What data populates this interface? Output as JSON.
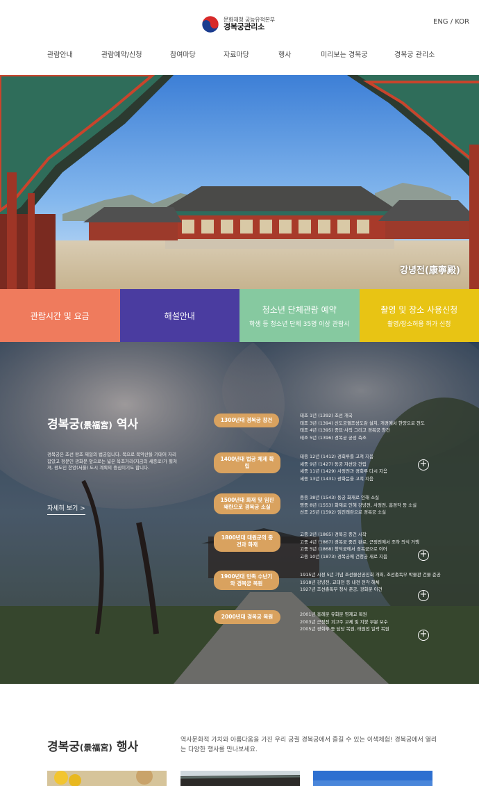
{
  "header": {
    "logo_sub": "문화재청 궁능유적본부",
    "logo_main": "경복궁관리소",
    "lang": "ENG / KOR"
  },
  "nav": [
    "관람안내",
    "관람예약/신청",
    "참여마당",
    "자료마당",
    "행사",
    "미리보는 경복궁",
    "경복궁 관리소"
  ],
  "hero": {
    "caption": "강녕전(康寧殿)"
  },
  "tiles": [
    {
      "title": "관람시간 및 요금",
      "sub": "",
      "color": "#ef7b5d"
    },
    {
      "title": "해설안내",
      "sub": "",
      "color": "#4a3ca0"
    },
    {
      "title": "청소년 단체관람 예약",
      "sub": "학생 등 청소년 단체 35명 이상 관람시",
      "color": "#86c9a0"
    },
    {
      "title": "촬영 및 장소 사용신청",
      "sub": "촬영/장소허용 허가 신청",
      "color": "#e8c414"
    }
  ],
  "history": {
    "title": "경복궁",
    "title_hanja": "(景福宮)",
    "title_suffix": "역사",
    "description": "경복궁은 조선 왕조 제일의 법궁입니다. 북으로 북악산을 기대어 자리 잡았고 정문인 광화문 앞으로는 넓은 육조거리(지금의 세종로)가 펼쳐져, 왕도인 한양(서울) 도시 계획의 중심이기도 합니다.",
    "more": "자세히 보기 >",
    "timeline": [
      {
        "label": "1300년대 경복궁 창건",
        "lines": [
          "태조 1년 (1392) 조선 개국",
          "태조 3년 (1394) 신도궁궐조성도감 설치, 개경에서 한양으로 천도",
          "태조 4년 (1395) 종묘·사직 그리고 경복궁 창건",
          "태조 5년 (1396) 경복궁 궁성 축조"
        ],
        "plus": false
      },
      {
        "label": "1400년대 법궁 체제 확립",
        "lines": [
          "태종 12년 (1412) 경회루를 고쳐 지음",
          "세종 9년 (1427) 동궁 자선당 건립",
          "세종 11년 (1429) 사정전과 경회루 다시 지음",
          "세종 13년 (1431) 광화문을 고쳐 지음"
        ],
        "plus": true
      },
      {
        "label": "1500년대 화재 및 임진왜란으로 경복궁 소실",
        "lines": [
          "중종 38년 (1543) 동궁 화재로 인해 소실",
          "명종 8년 (1553) 화재로 인해 강녕전, 사정전, 흠경각 등 소실",
          "선조 25년 (1592) 임진왜란으로 경복궁 소실"
        ],
        "plus": false
      },
      {
        "label": "1800년대 대원군의 중건과 화재",
        "lines": [
          "고종 2년 (1865) 경복궁 중건 시작",
          "고종 4년 (1867) 경복궁 중건 완료, 근정전에서 조하 의식 거행",
          "고종 5년 (1868) 창덕궁에서 경복궁으로 이어",
          "고종 10년 (1873) 경복궁에 건청궁 새로 지음"
        ],
        "plus": true
      },
      {
        "label": "1900년대 민족 수난기와 경복궁 복원",
        "lines": [
          "1915년 시정 5년 기념 조선물산공진회 개최, 조선총독부 박물관 건물 준공",
          "1918년 강녕전, 교태전 등 내전 전각 해체",
          "1927년 조선총독부 청사 준공, 광화문 이건"
        ],
        "plus": true
      },
      {
        "label": "2000년대 경복궁 복원",
        "lines": [
          "2001년 흥례문 유화문 영제교 복원",
          "2003년 근정전 괴고주 교체 및 지붕 부분 보수",
          "2005년 경회루 등 담당 복원, 태원전 일곽 복원"
        ],
        "plus": true
      }
    ]
  },
  "events": {
    "title": "경복궁",
    "title_hanja": "(景福宮)",
    "title_suffix": "행사",
    "description": "역사문화적 가치와 아름다움을 가진 우리 궁궐 경복궁에서 즐길 수 있는 이색체험! 경복궁에서 열리는 다양한 행사를 만나보세요."
  },
  "colors": {
    "accent": "#d9a25f",
    "text": "#333333"
  }
}
